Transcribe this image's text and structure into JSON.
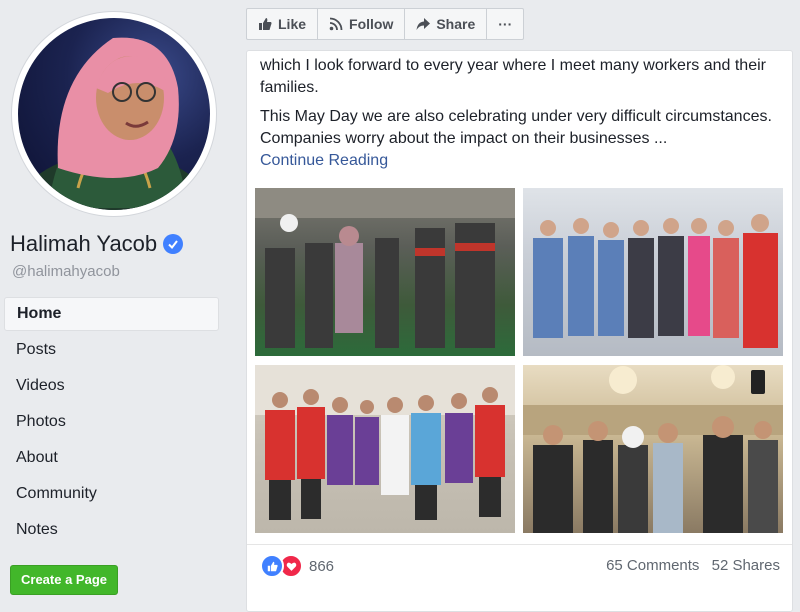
{
  "page": {
    "name": "Halimah Yacob",
    "handle": "@halimahyacob"
  },
  "nav": {
    "items": [
      {
        "label": "Home",
        "active": true
      },
      {
        "label": "Posts"
      },
      {
        "label": "Videos"
      },
      {
        "label": "Photos"
      },
      {
        "label": "About"
      },
      {
        "label": "Community"
      },
      {
        "label": "Notes"
      }
    ],
    "create_page_label": "Create a Page"
  },
  "actions": {
    "like_label": "Like",
    "follow_label": "Follow",
    "share_label": "Share",
    "more_label": "···"
  },
  "post": {
    "text_line1": "which I look forward to every year where I meet many workers and their families.",
    "text_line2": "This May Day we are also celebrating under very difficult circumstances. Companies worry about the impact on their businesses ...",
    "continue_label": "Continue Reading",
    "reaction_count": "866",
    "comments": "65 Comments",
    "shares": "52 Shares"
  },
  "colors": {
    "accent": "#365899",
    "like_blue": "#4080ff",
    "love_red": "#f0284a",
    "create_green": "#42b72a"
  },
  "icons": {
    "verified": "verified-badge-icon",
    "like": "thumbs-up-icon",
    "follow": "rss-icon",
    "share": "share-arrow-icon",
    "more": "more-dots-icon"
  }
}
